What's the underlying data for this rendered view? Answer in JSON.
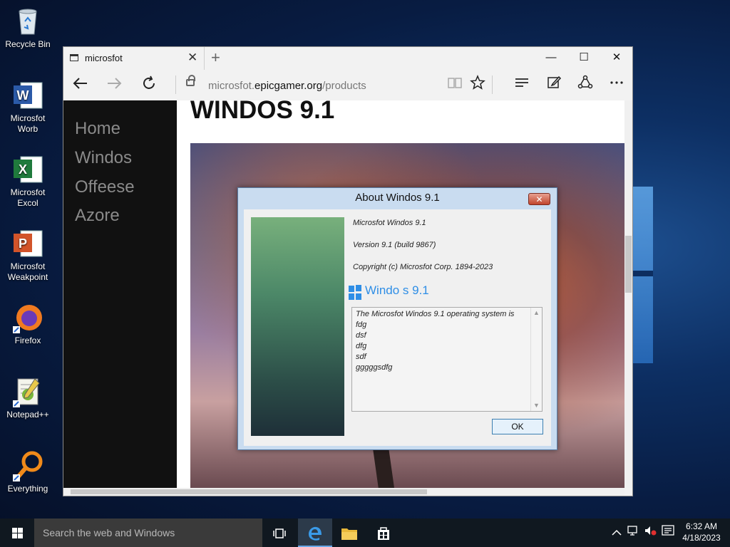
{
  "desktop": {
    "icons": [
      {
        "label": "Recycle Bin",
        "icon": "recycle-bin-icon"
      },
      {
        "label": "Microsfot Worb",
        "icon": "word-icon"
      },
      {
        "label": "Microsfot Excol",
        "icon": "excel-icon"
      },
      {
        "label": "Microsfot Weakpoint",
        "icon": "powerpoint-icon"
      },
      {
        "label": "Firefox",
        "icon": "firefox-icon"
      },
      {
        "label": "Notepad++",
        "icon": "notepad-plus-plus-icon"
      },
      {
        "label": "Everything",
        "icon": "everything-search-icon"
      }
    ]
  },
  "browser": {
    "tab_title": "microsfot",
    "tab_close": "✕",
    "new_tab": "+",
    "window_controls": {
      "minimize": "—",
      "maximize": "☐",
      "close": "✕"
    },
    "url": {
      "prefix": "microsfot.",
      "domain": "epicgamer.org",
      "path": "/products"
    },
    "page": {
      "nav": [
        "Home",
        "Windos",
        "Offeese",
        "Azore"
      ],
      "heading": "WINDOS 9.1"
    }
  },
  "dialog": {
    "title": "About Windos 9.1",
    "close": "✕",
    "product": "Microsfot Windos 9.1",
    "version": "Version 9.1 (build 9867)",
    "copyright": "Copyright (c) Microsfot Corp. 1894-2023",
    "logo_text": "Windo  s 9.1",
    "text_lines": [
      "The Microsfot Windos 9.1 operating system is",
      "fdg",
      "dsf",
      "dfg",
      "sdf",
      "gggggsdfg"
    ],
    "ok_label": "OK"
  },
  "taskbar": {
    "search_placeholder": "Search the web and Windows",
    "time": "6:32 AM",
    "date": "4/18/2023"
  },
  "colors": {
    "accent": "#2e8ee6",
    "taskbar": "#101820",
    "sidenav": "#111111"
  }
}
